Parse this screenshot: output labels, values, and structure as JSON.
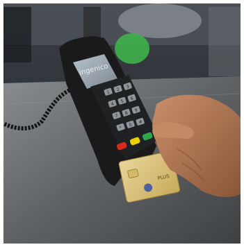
{
  "photo": {
    "terminal_brand": "ingenico",
    "card_text": "PLUS",
    "keys": [
      "1",
      "2",
      "3",
      "4",
      "5",
      "6",
      "7",
      "8",
      "9",
      "*",
      "0",
      "#"
    ]
  }
}
